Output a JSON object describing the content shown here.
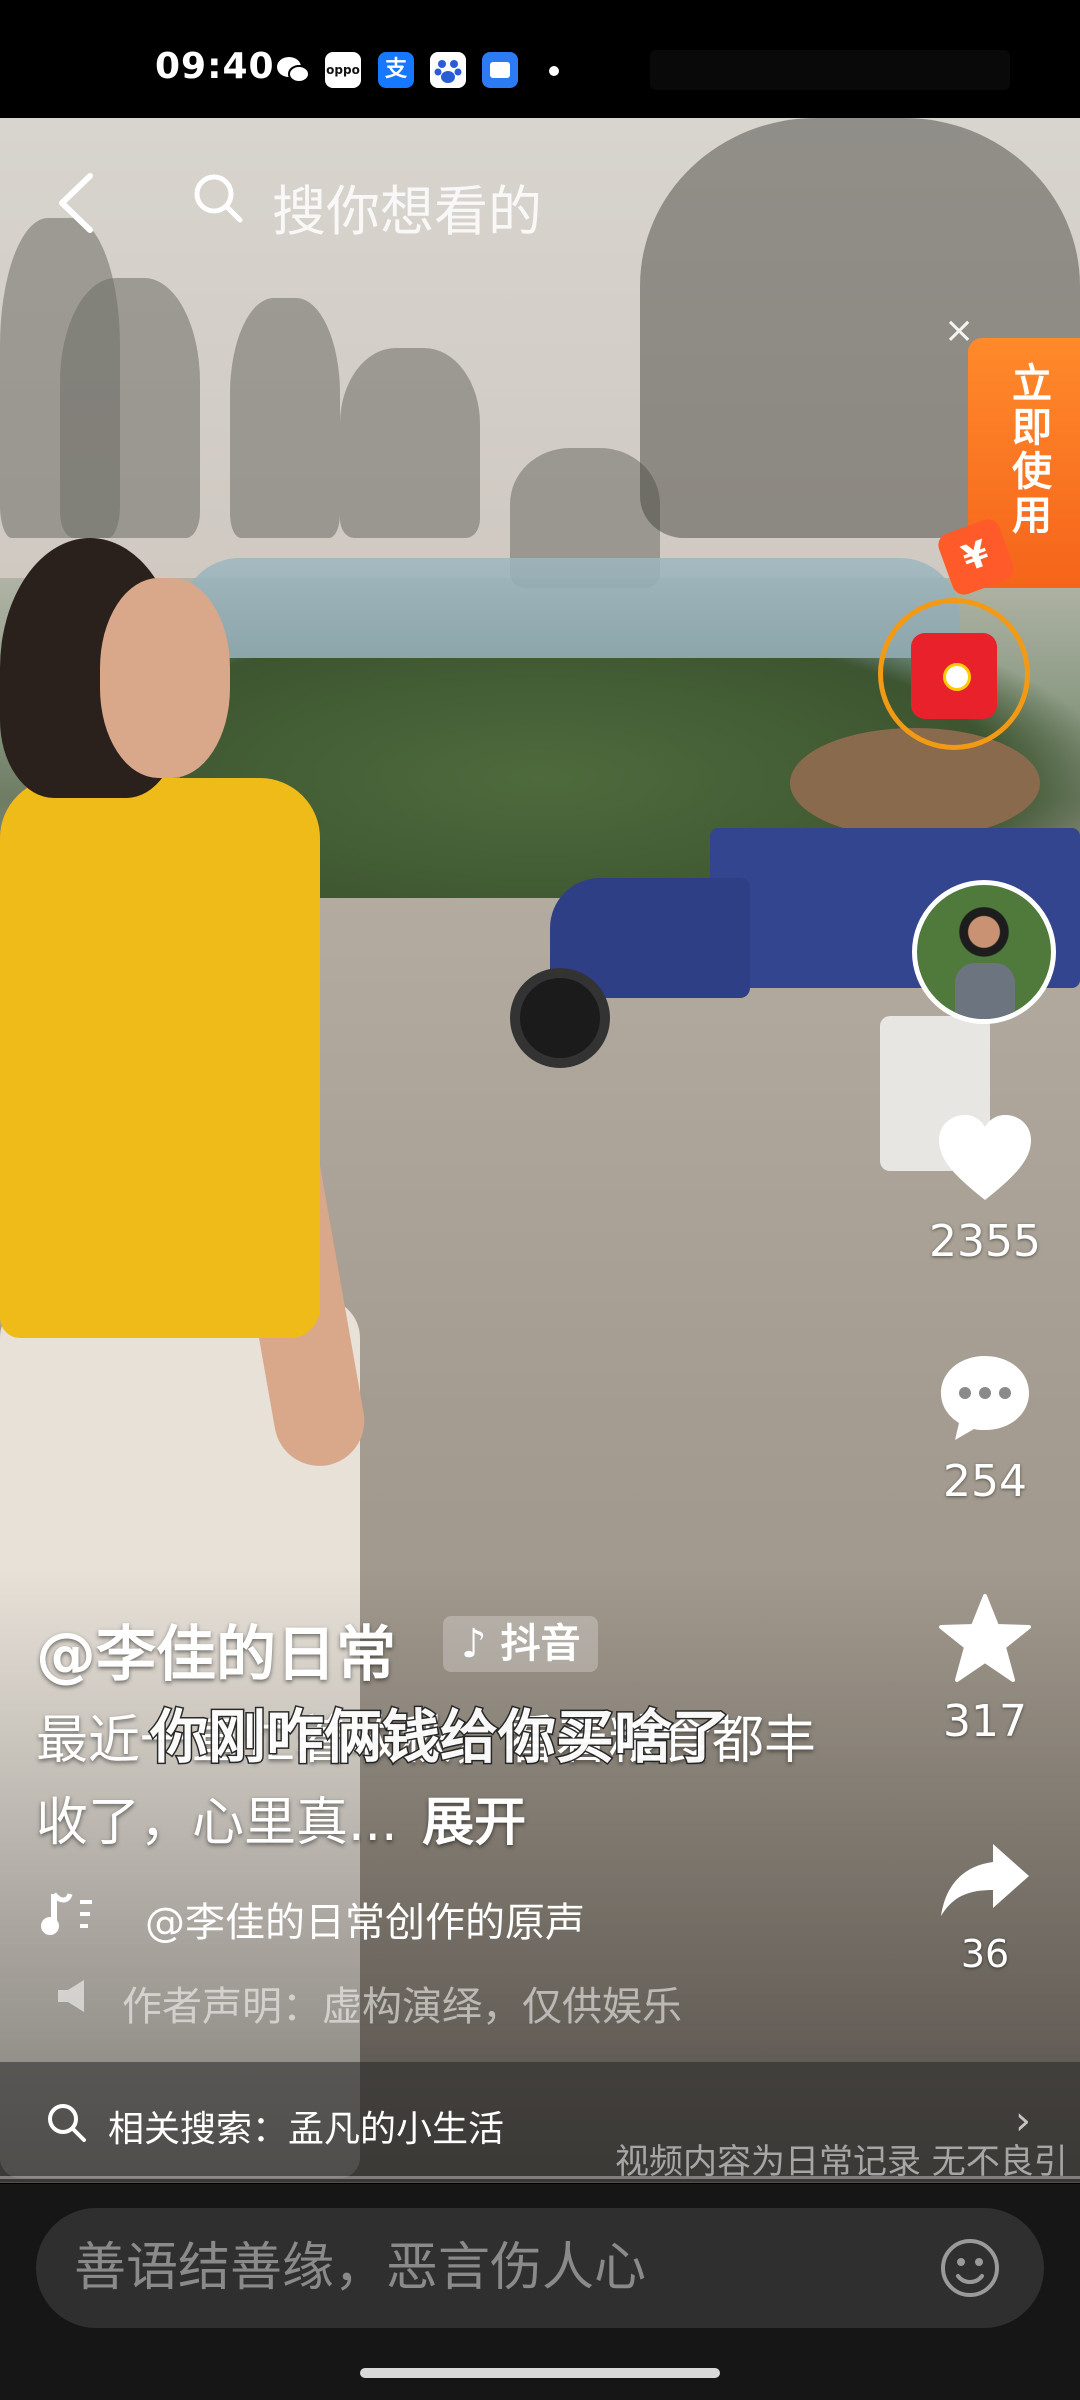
{
  "status_bar": {
    "time": "09:40",
    "app_icons": [
      {
        "name": "wechat-icon",
        "color": "#000000"
      },
      {
        "name": "oppo-icon",
        "color": "#ffffff",
        "label": "oppo"
      },
      {
        "name": "alipay-icon",
        "color": "#1677ff",
        "label": "支"
      },
      {
        "name": "baidu-icon",
        "color": "#ffffff"
      },
      {
        "name": "files-icon",
        "color": "#2d7bf4"
      }
    ]
  },
  "top_bar": {
    "search_placeholder": "搜你想看的"
  },
  "promo": {
    "close": "×",
    "label": "立即使用",
    "coin_symbol": "¥"
  },
  "actions": {
    "like_count": "2355",
    "comment_count": "254",
    "favorite_count": "317",
    "share_count": "36"
  },
  "video": {
    "author": "@李佳的日常",
    "platform_badge": "抖音",
    "description": "最近一直忙着收秋，看着粮食都丰收了，心里真...",
    "expand": "展开",
    "subtitle": "你刚咋俩钱给你买啥了",
    "music": "@李佳的日常创作的原声",
    "notice": "作者声明：虚构演绎，仅供娱乐",
    "watermark": "视频内容为日常记录 无不良引"
  },
  "related": {
    "text": "相关搜索：孟凡的小生活"
  },
  "comment": {
    "placeholder": "善语结善缘，恶言伤人心"
  },
  "colors": {
    "promo_orange": "#f5641a",
    "redpacket_ring": "#f39a14",
    "redpacket_red": "#e8212a"
  }
}
